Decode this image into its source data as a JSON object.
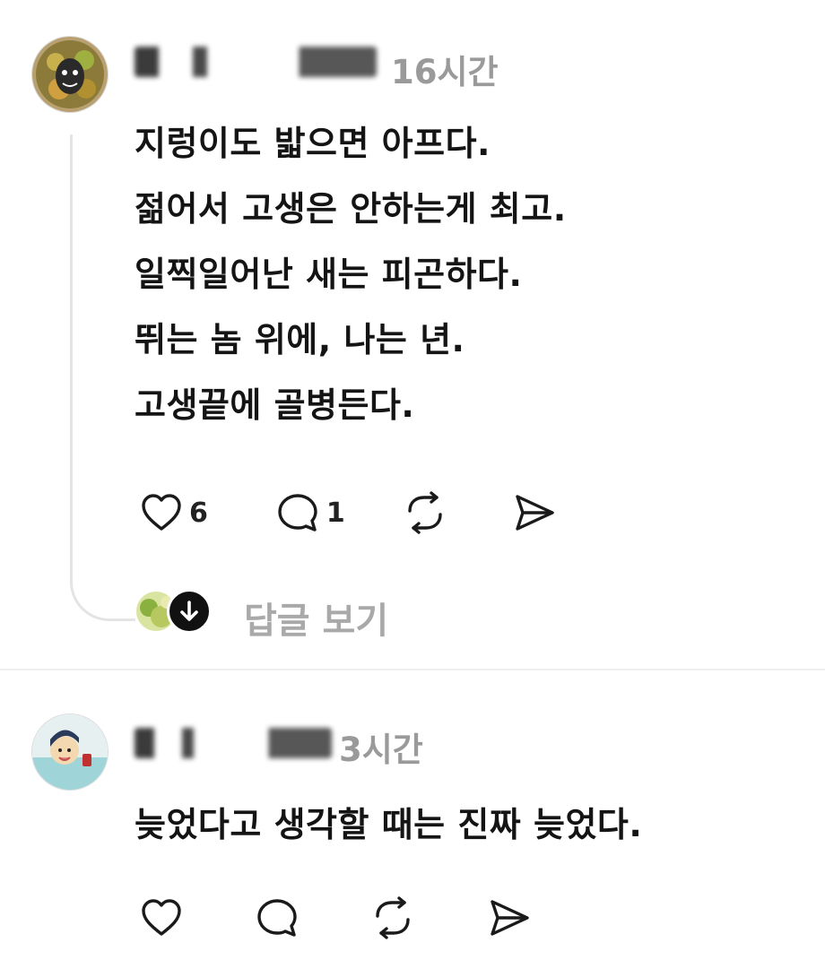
{
  "comments": [
    {
      "username": "",
      "time": "16시간",
      "lines": [
        "지렁이도 밟으면 아프다.",
        "젊어서 고생은 안하는게 최고.",
        "일찍일어난 새는 피곤하다.",
        "뛰는 놈 위에, 나는 년.",
        "고생끝에 골병든다."
      ],
      "likes": "6",
      "replies": "1",
      "view_replies": "답글 보기"
    },
    {
      "username": "",
      "time": "3시간",
      "lines": [
        "늦었다고 생각할 때는 진짜 늦었다."
      ]
    }
  ],
  "icons": {
    "like": "heart-icon",
    "reply": "speech-bubble-icon",
    "repost": "repost-icon",
    "share": "send-icon",
    "expand": "arrow-down-icon"
  },
  "colors": {
    "text": "#141414",
    "muted": "#9a9a9a",
    "divider": "#eeeeee"
  }
}
